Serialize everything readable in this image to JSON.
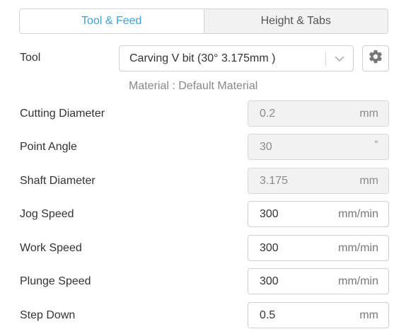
{
  "tabs": [
    {
      "label": "Tool & Feed",
      "active": true
    },
    {
      "label": "Height & Tabs",
      "active": false
    }
  ],
  "tool": {
    "label": "Tool",
    "selected": "Carving V bit (30° 3.175mm )",
    "chevron_icon": "chevron-down-icon",
    "settings_icon": "gear-icon"
  },
  "material": "Material : Default Material",
  "fields": {
    "cutting_diameter": {
      "label": "Cutting Diameter",
      "value": "0.2",
      "unit": "mm",
      "disabled": true
    },
    "point_angle": {
      "label": "Point Angle",
      "value": "30",
      "unit": "°",
      "disabled": true
    },
    "shaft_diameter": {
      "label": "Shaft Diameter",
      "value": "3.175",
      "unit": "mm",
      "disabled": true
    },
    "jog_speed": {
      "label": "Jog Speed",
      "value": "300",
      "unit": "mm/min",
      "disabled": false
    },
    "work_speed": {
      "label": "Work Speed",
      "value": "300",
      "unit": "mm/min",
      "disabled": false
    },
    "plunge_speed": {
      "label": "Plunge Speed",
      "value": "300",
      "unit": "mm/min",
      "disabled": false
    },
    "step_down": {
      "label": "Step Down",
      "value": "0.5",
      "unit": "mm",
      "disabled": false
    }
  },
  "colors": {
    "accent": "#3ba2d6",
    "disabled_bg": "#f2f2f2",
    "border": "#cfcfcf"
  }
}
